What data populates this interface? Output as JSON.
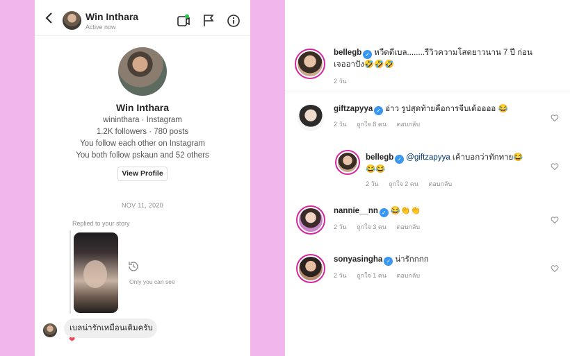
{
  "dm": {
    "header": {
      "name": "Win Inthara",
      "status": "Active now"
    },
    "profile": {
      "name": "Win Inthara",
      "handle_line": "wininthara · Instagram",
      "stats_line": "1.2K followers · 780 posts",
      "follow_line": "You follow each other on Instagram",
      "mutual_line": "You both follow pskaun and 52 others",
      "view_profile_label": "View Profile"
    },
    "date_separator": "NOV 11, 2020",
    "replied_label": "Replied to your story",
    "only_you_label": "Only you can see",
    "message_text": "เบลน่ารักเหมือนเดิมครับ",
    "reaction": "❤"
  },
  "comments": [
    {
      "username": "bellegb",
      "text": "หวีดตีเบล........รีวิวความโสดยาวนาน 7 ปี ก่อน",
      "text_line2": "เจออาปัง🤣🤣🤣",
      "time": "2 วัน"
    },
    {
      "username": "giftzapyya",
      "text": "อ่าว รูปสุดท้ายคือการจีบเด้ออออ 😂",
      "time": "2 วัน",
      "likes": "ถูกใจ 8 คน",
      "reply_label": "ตอบกลับ"
    },
    {
      "username": "bellegb",
      "mention": "@giftzapyya",
      "text": " เค้าบอกว่าทักทาย😂",
      "text_line2": "😂😂",
      "time": "2 วัน",
      "likes": "ถูกใจ 2 คน",
      "reply_label": "ตอบกลับ"
    },
    {
      "username": "nannie__nn",
      "text": "😂👏👏",
      "time": "2 วัน",
      "likes": "ถูกใจ 3 คน",
      "reply_label": "ตอบกลับ"
    },
    {
      "username": "sonyasingha",
      "text": "น่ารักกกก",
      "time": "2 วัน",
      "likes": "ถูกใจ 1 คน",
      "reply_label": "ตอบกลับ"
    }
  ],
  "colors": {
    "background": "#f1b7ec",
    "verified": "#3897f0",
    "ring": "#d6249f"
  },
  "icons": [
    "back-icon",
    "video-call-icon",
    "flag-icon",
    "info-icon",
    "history-icon",
    "heart-icon",
    "verified-badge-icon"
  ]
}
